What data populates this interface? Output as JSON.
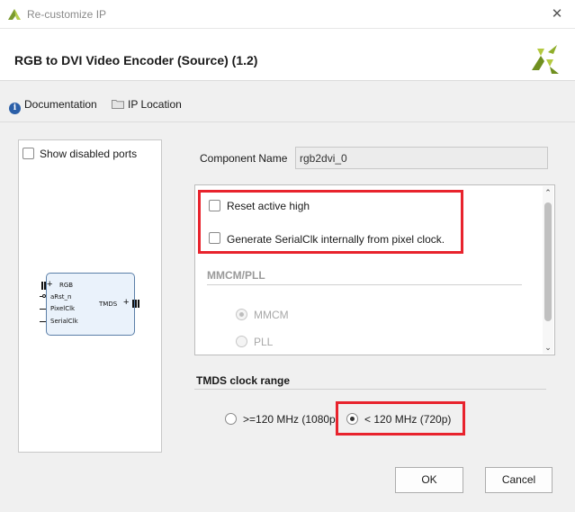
{
  "window": {
    "title": "Re-customize IP",
    "close_glyph": "✕"
  },
  "header": {
    "ip_title": "RGB to DVI Video Encoder (Source) (1.2)",
    "logo_icon": "xilinx-logo-icon"
  },
  "toolbar": {
    "documentation_label": "Documentation",
    "ip_location_label": "IP Location"
  },
  "preview": {
    "show_disabled_ports_label": "Show disabled ports",
    "show_disabled_ports_checked": false,
    "left_ports": [
      "RGB",
      "aRst_n",
      "PixelClk",
      "SerialClk"
    ],
    "right_ports": [
      "TMDS"
    ]
  },
  "config": {
    "component_name_label": "Component Name",
    "component_name_value": "rgb2dvi_0",
    "reset_active_high_label": "Reset active high",
    "reset_active_high_checked": false,
    "generate_serialclk_label": "Generate SerialClk internally from pixel clock.",
    "generate_serialclk_checked": false,
    "mmcm_pll_section": "MMCM/PLL",
    "mmcm_label": "MMCM",
    "pll_label": "PLL",
    "mmcm_pll_selected": "MMCM",
    "tmds_section": "TMDS clock range",
    "tmds_option_high": ">=120 MHz (1080p",
    "tmds_option_low": "< 120 MHz (720p)",
    "tmds_selected": "< 120 MHz (720p)"
  },
  "footer": {
    "ok_label": "OK",
    "cancel_label": "Cancel"
  },
  "colors": {
    "highlight": "#e8232d",
    "symbol_fill": "#eaf2fb",
    "symbol_border": "#5b7fa8"
  }
}
